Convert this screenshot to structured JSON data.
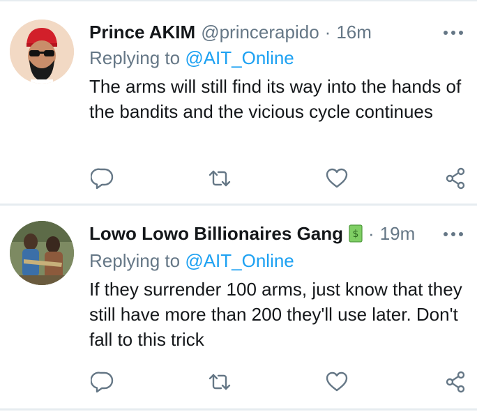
{
  "tweets": [
    {
      "name": "Prince AKIM",
      "handle": "@princerapido",
      "separator": "·",
      "time": "16m",
      "reply_prefix": "Replying to ",
      "reply_target": "@AIT_Online",
      "text": "The arms will still find its way into the hands of the bandits and the vicious cycle continues",
      "avatar_icon": "avatar-red-cap-sunglasses",
      "badge_icon": null
    },
    {
      "name": "Lowo Lowo Billionaires Gang",
      "handle": "",
      "separator": "·",
      "time": "19m",
      "reply_prefix": "Replying to ",
      "reply_target": "@AIT_Online",
      "text": "If they surrender 100 arms, just know that they still have more than 200 they'll use later. Don't fall to this trick",
      "avatar_icon": "avatar-photo-people",
      "badge_icon": "money-emoji-icon"
    }
  ],
  "colors": {
    "text": "#14171a",
    "secondary": "#657786",
    "link": "#1da1f2",
    "border": "#e6ecf0"
  },
  "actions": [
    "reply-icon",
    "retweet-icon",
    "like-icon",
    "share-icon"
  ]
}
